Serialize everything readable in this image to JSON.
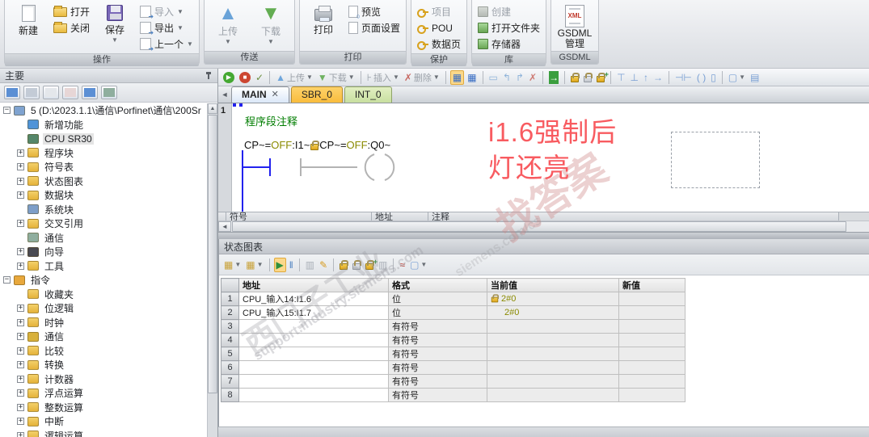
{
  "ribbon": {
    "operation": {
      "label": "操作",
      "new": "新建",
      "open": "打开",
      "close": "关闭",
      "save": "保存",
      "import": "导入",
      "export": "导出",
      "previous": "上一个"
    },
    "transfer": {
      "label": "传送",
      "upload": "上传",
      "download": "下载"
    },
    "print": {
      "label": "打印",
      "print": "打印",
      "preview": "预览",
      "page_setup": "页面设置"
    },
    "protection": {
      "label": "保护",
      "project": "项目",
      "pou": "POU",
      "data_page": "数据页"
    },
    "library": {
      "label": "库",
      "create": "创建",
      "open_folder": "打开文件夹",
      "memory": "存储器"
    },
    "gsdml": {
      "label": "GSDML",
      "manage_line1": "GSDML",
      "manage_line2": "管理"
    }
  },
  "sidebar": {
    "title": "主要",
    "toolbar_icons": [
      "view-toggle-icon",
      "grid-view-icon",
      "document-view-icon",
      "report-view-icon",
      "list-view-icon",
      "monitor-view-icon"
    ],
    "tree": [
      {
        "label": "5 (D:\\2023.1.1\\通信\\Porfinet\\通信\\200Sr",
        "level": 0,
        "exp": "-",
        "icon": "project"
      },
      {
        "label": "新增功能",
        "level": 1,
        "exp": "",
        "icon": "new-features"
      },
      {
        "label": "CPU SR30",
        "level": 1,
        "exp": "",
        "icon": "cpu",
        "selected": true
      },
      {
        "label": "程序块",
        "level": 1,
        "exp": "+",
        "icon": "program-block"
      },
      {
        "label": "符号表",
        "level": 1,
        "exp": "+",
        "icon": "symbol-table"
      },
      {
        "label": "状态图表",
        "level": 1,
        "exp": "+",
        "icon": "status-chart"
      },
      {
        "label": "数据块",
        "level": 1,
        "exp": "+",
        "icon": "data-block"
      },
      {
        "label": "系统块",
        "level": 1,
        "exp": "",
        "icon": "system-block"
      },
      {
        "label": "交叉引用",
        "level": 1,
        "exp": "+",
        "icon": "cross-reference"
      },
      {
        "label": "通信",
        "level": 1,
        "exp": "",
        "icon": "communication"
      },
      {
        "label": "向导",
        "level": 1,
        "exp": "+",
        "icon": "wizard"
      },
      {
        "label": "工具",
        "level": 1,
        "exp": "+",
        "icon": "tools"
      },
      {
        "label": "指令",
        "level": 0,
        "exp": "-",
        "icon": "instructions"
      },
      {
        "label": "收藏夹",
        "level": 1,
        "exp": "",
        "icon": "favorites"
      },
      {
        "label": "位逻辑",
        "level": 1,
        "exp": "+",
        "icon": "bit-logic"
      },
      {
        "label": "时钟",
        "level": 1,
        "exp": "+",
        "icon": "clock"
      },
      {
        "label": "通信",
        "level": 1,
        "exp": "+",
        "icon": "comm-instructions"
      },
      {
        "label": "比较",
        "level": 1,
        "exp": "+",
        "icon": "compare"
      },
      {
        "label": "转换",
        "level": 1,
        "exp": "+",
        "icon": "convert"
      },
      {
        "label": "计数器",
        "level": 1,
        "exp": "+",
        "icon": "counter"
      },
      {
        "label": "浮点运算",
        "level": 1,
        "exp": "+",
        "icon": "float-math"
      },
      {
        "label": "整数运算",
        "level": 1,
        "exp": "+",
        "icon": "int-math"
      },
      {
        "label": "中断",
        "level": 1,
        "exp": "+",
        "icon": "interrupt"
      },
      {
        "label": "逻辑运算",
        "level": 1,
        "exp": "+",
        "icon": "logic-op"
      }
    ]
  },
  "editor": {
    "toolbar": {
      "upload": "上传",
      "download": "下载",
      "insert": "插入",
      "delete": "删除"
    },
    "tabs": [
      {
        "label": "MAIN",
        "active": true,
        "closable": true
      },
      {
        "label": "SBR_0"
      },
      {
        "label": "INT_0"
      }
    ],
    "network_number": "1",
    "comment": "程序段注释",
    "rung": {
      "p1": "CP~=",
      "p2": "OFF",
      "p3": ":I1~",
      "p4": "CP~=",
      "p5": "OFF",
      "p6": ":Q0~"
    },
    "annotation_line1": "i1.6强制后",
    "annotation_line2": "灯还亮",
    "symbol_header": [
      "符号",
      "地址",
      "注释"
    ]
  },
  "status_chart": {
    "title": "状态图表",
    "columns": [
      "地址",
      "格式",
      "当前值",
      "新值"
    ],
    "rows": [
      {
        "num": "1",
        "address": "CPU_输入14:I1.6",
        "format": "位",
        "current": "2#0",
        "locked": true,
        "new_value": ""
      },
      {
        "num": "2",
        "address": "CPU_输入15:I1.7",
        "format": "位",
        "current": "2#0",
        "locked": false,
        "new_value": ""
      },
      {
        "num": "3",
        "address": "",
        "format": "有符号",
        "current": "",
        "locked": false,
        "new_value": ""
      },
      {
        "num": "4",
        "address": "",
        "format": "有符号",
        "current": "",
        "locked": false,
        "new_value": ""
      },
      {
        "num": "5",
        "address": "",
        "format": "有符号",
        "current": "",
        "locked": false,
        "new_value": ""
      },
      {
        "num": "6",
        "address": "",
        "format": "有符号",
        "current": "",
        "locked": false,
        "new_value": ""
      },
      {
        "num": "7",
        "address": "",
        "format": "有符号",
        "current": "",
        "locked": false,
        "new_value": ""
      },
      {
        "num": "8",
        "address": "",
        "format": "有符号",
        "current": "",
        "locked": false,
        "new_value": ""
      }
    ]
  },
  "watermarks": [
    "找答案",
    "西门子工业",
    "support.industry.siemens.com",
    "siemens.com/cs"
  ],
  "colors": {
    "accent_run": "#44a832",
    "accent_stop": "#cc4631",
    "force_lock": "#dfa61d",
    "annotation_red": "#f85b60",
    "comment_green": "#007d00",
    "value_olive": "#8a8a00"
  }
}
